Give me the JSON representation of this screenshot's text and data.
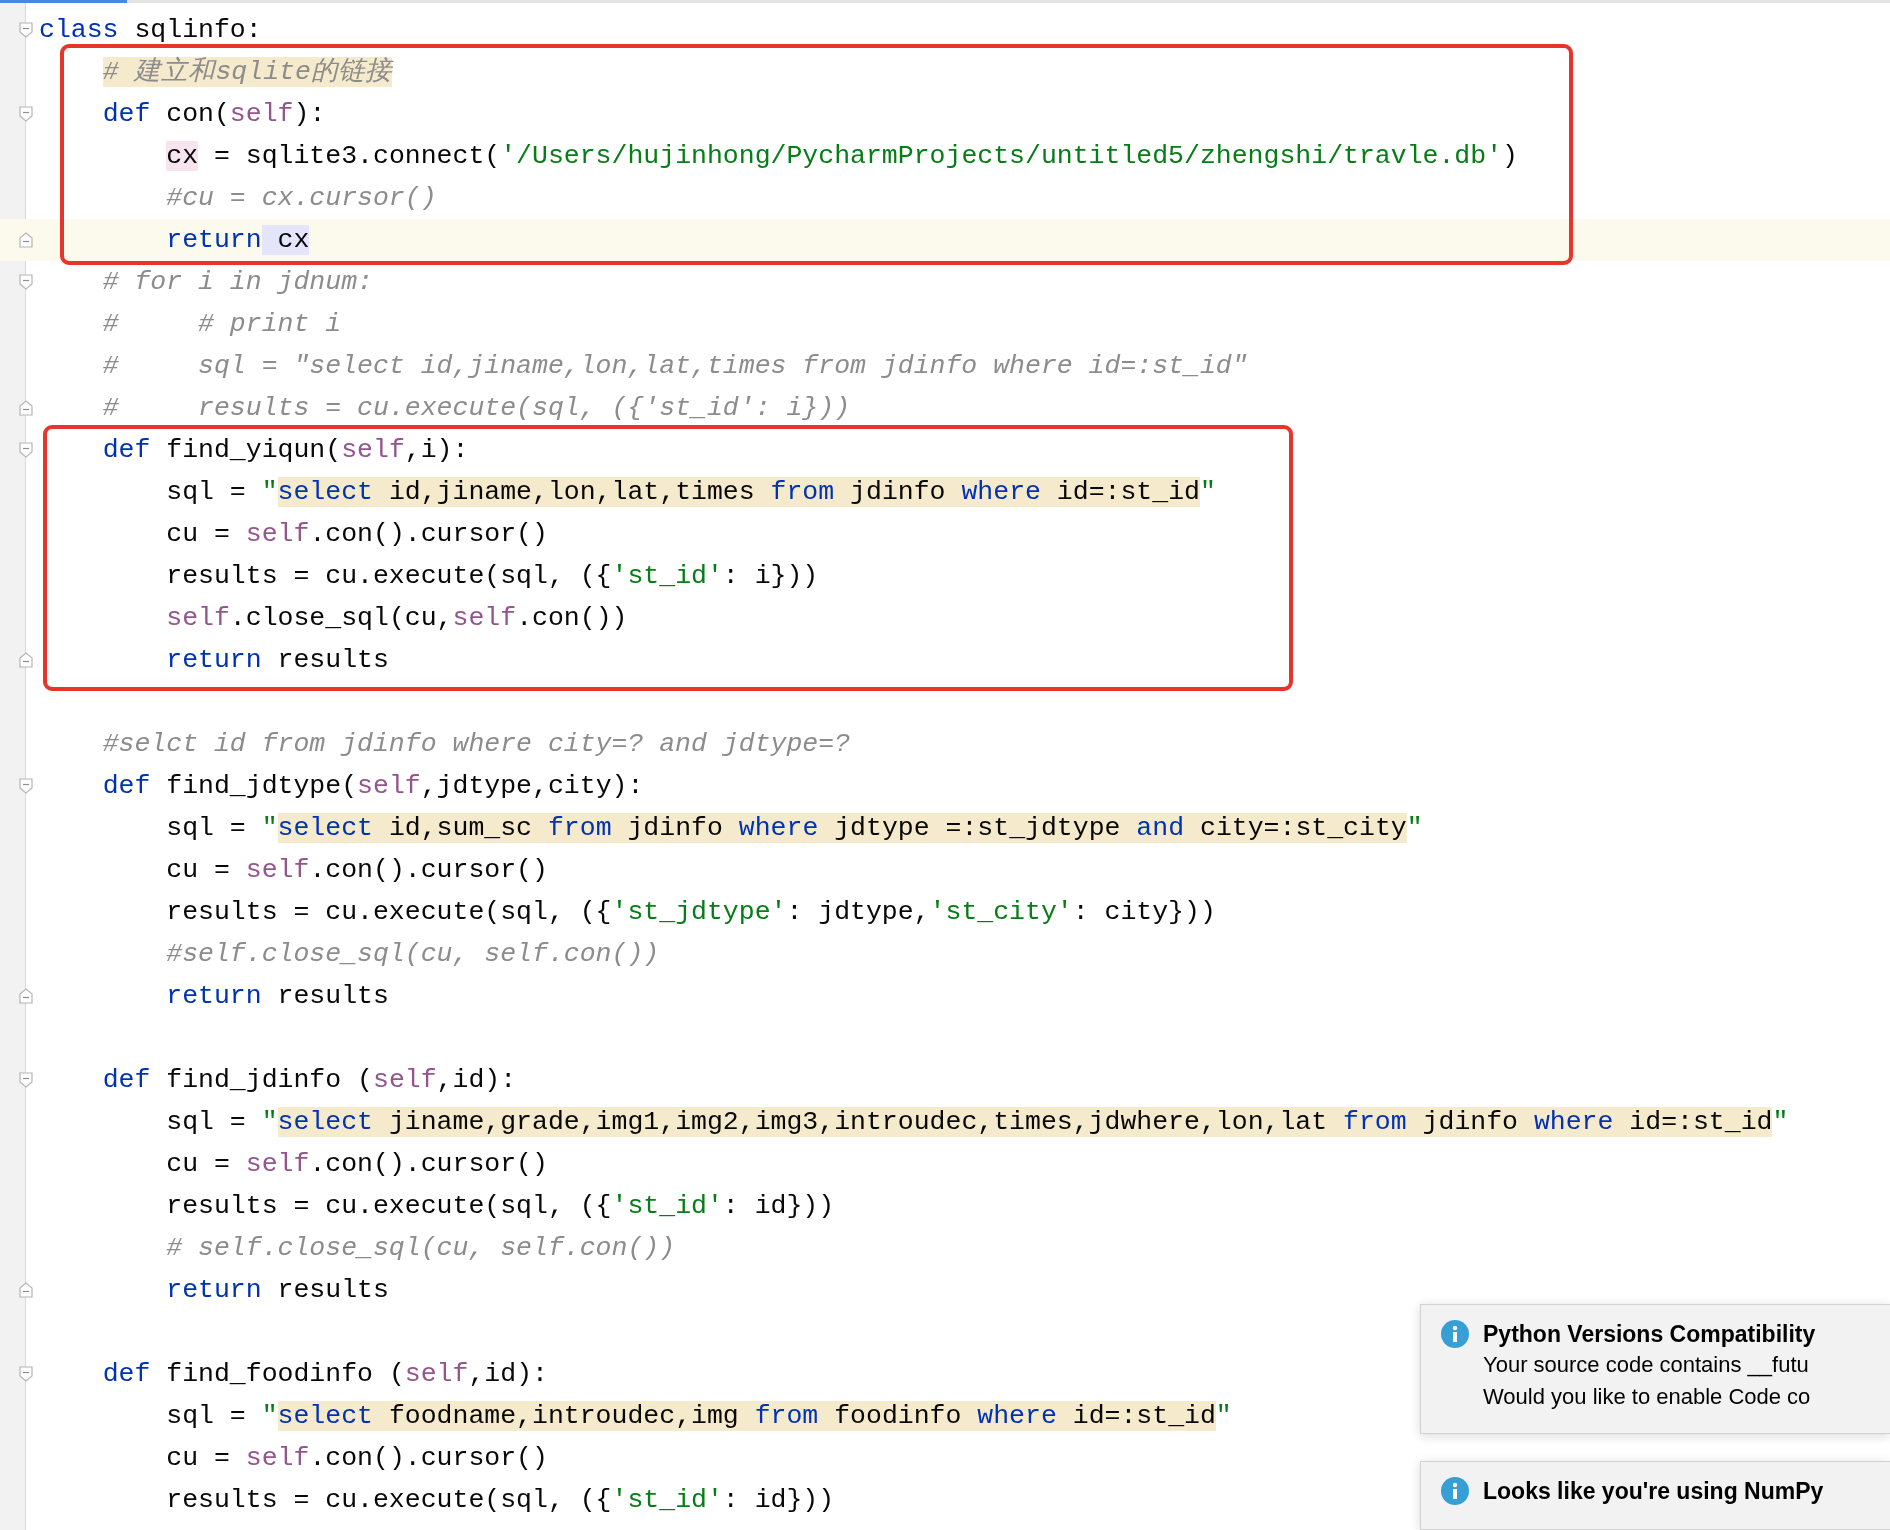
{
  "segments": [
    {
      "kind": "plain",
      "lines": [
        {
          "fold_start": true,
          "fold_end": false,
          "current": false,
          "tokens": [
            {
              "text": "class",
              "kind": "kw"
            },
            {
              "text": " sqlinfo:",
              "kind": "plain"
            }
          ]
        }
      ]
    },
    {
      "kind": "highlight-box",
      "lines": [
        {
          "fold_start": false,
          "fold_end": false,
          "current": false,
          "tokens": [
            {
              "text": "    # 建立和sqlite的链接",
              "kind": "comment-hl"
            }
          ]
        },
        {
          "fold_start": true,
          "fold_end": false,
          "current": false,
          "tokens": [
            {
              "text": "    def",
              "kind": "kw"
            },
            {
              "text": " con(",
              "kind": "plain"
            },
            {
              "text": "self",
              "kind": "self"
            },
            {
              "text": "):",
              "kind": "plain"
            }
          ]
        },
        {
          "fold_start": false,
          "fold_end": false,
          "current": false,
          "tokens": [
            {
              "text": "        cx",
              "kind": "decl"
            },
            {
              "text": " = sqlite3.connect(",
              "kind": "plain"
            },
            {
              "text": "'/Users/hujinhong/PycharmProjects/untitled5/zhengshi/travle.db'",
              "kind": "str"
            },
            {
              "text": ")",
              "kind": "plain"
            }
          ]
        },
        {
          "fold_start": false,
          "fold_end": false,
          "current": false,
          "tokens": [
            {
              "text": "        #cu = cx.cursor()",
              "kind": "comment"
            }
          ]
        },
        {
          "fold_start": false,
          "fold_end": true,
          "current": true,
          "tokens": [
            {
              "text": "        return",
              "kind": "kw"
            },
            {
              "text": " cx",
              "kind": "usage"
            }
          ]
        }
      ]
    },
    {
      "kind": "plain",
      "lines": [
        {
          "fold_start": true,
          "fold_end": false,
          "current": false,
          "tokens": [
            {
              "text": "    # for i in jdnum:",
              "kind": "comment"
            }
          ]
        },
        {
          "fold_start": false,
          "fold_end": false,
          "current": false,
          "tokens": [
            {
              "text": "    #     # print i",
              "kind": "comment"
            }
          ]
        },
        {
          "fold_start": false,
          "fold_end": false,
          "current": false,
          "tokens": [
            {
              "text": "    #     sql = \"select id,jiname,lon,lat,times from jdinfo where id=:st_id\"",
              "kind": "comment"
            }
          ]
        },
        {
          "fold_start": false,
          "fold_end": true,
          "current": false,
          "tokens": [
            {
              "text": "    #     results = cu.execute(sql, ({'st_id': i}))",
              "kind": "comment"
            }
          ]
        }
      ]
    },
    {
      "kind": "highlight-box",
      "lines": [
        {
          "fold_start": true,
          "fold_end": false,
          "current": false,
          "tokens": [
            {
              "text": "    def",
              "kind": "kw"
            },
            {
              "text": " find_yiqun(",
              "kind": "plain"
            },
            {
              "text": "self",
              "kind": "self"
            },
            {
              "text": ",i):",
              "kind": "plain"
            }
          ]
        },
        {
          "fold_start": false,
          "fold_end": false,
          "current": false,
          "tokens": [
            {
              "text": "        sql = ",
              "kind": "plain"
            },
            {
              "text": "\"",
              "kind": "str"
            },
            {
              "text": "select",
              "kind": "sqlkw"
            },
            {
              "text": " id,jiname,lon,lat,times ",
              "kind": "sql"
            },
            {
              "text": "from",
              "kind": "sqlkw"
            },
            {
              "text": " jdinfo ",
              "kind": "sql"
            },
            {
              "text": "where",
              "kind": "sqlkw"
            },
            {
              "text": " id=:st_id",
              "kind": "sql"
            },
            {
              "text": "\"",
              "kind": "str"
            }
          ]
        },
        {
          "fold_start": false,
          "fold_end": false,
          "current": false,
          "tokens": [
            {
              "text": "        cu = ",
              "kind": "plain"
            },
            {
              "text": "self",
              "kind": "self"
            },
            {
              "text": ".con().cursor()",
              "kind": "plain"
            }
          ]
        },
        {
          "fold_start": false,
          "fold_end": false,
          "current": false,
          "tokens": [
            {
              "text": "        results = cu.execute(sql, ({",
              "kind": "plain"
            },
            {
              "text": "'st_id'",
              "kind": "str"
            },
            {
              "text": ": i}))",
              "kind": "plain"
            }
          ]
        },
        {
          "fold_start": false,
          "fold_end": false,
          "current": false,
          "tokens": [
            {
              "text": "        self",
              "kind": "self"
            },
            {
              "text": ".close_sql(cu,",
              "kind": "plain"
            },
            {
              "text": "self",
              "kind": "self"
            },
            {
              "text": ".con())",
              "kind": "plain"
            }
          ]
        },
        {
          "fold_start": false,
          "fold_end": true,
          "current": false,
          "tokens": [
            {
              "text": "        return",
              "kind": "kw"
            },
            {
              "text": " results",
              "kind": "plain"
            }
          ]
        }
      ]
    },
    {
      "kind": "spaced",
      "lines": [
        {
          "fold_start": false,
          "fold_end": false,
          "current": false,
          "tokens": [
            {
              "text": "    #selct id from jdinfo where city=? and jdtype=?",
              "kind": "comment"
            }
          ]
        },
        {
          "fold_start": true,
          "fold_end": false,
          "current": false,
          "tokens": [
            {
              "text": "    def",
              "kind": "kw"
            },
            {
              "text": " find_jdtype(",
              "kind": "plain"
            },
            {
              "text": "self",
              "kind": "self"
            },
            {
              "text": ",jdtype,city):",
              "kind": "plain"
            }
          ]
        },
        {
          "fold_start": false,
          "fold_end": false,
          "current": false,
          "tokens": [
            {
              "text": "        sql = ",
              "kind": "plain"
            },
            {
              "text": "\"",
              "kind": "str"
            },
            {
              "text": "select",
              "kind": "sqlkw"
            },
            {
              "text": " id,sum_sc ",
              "kind": "sql"
            },
            {
              "text": "from",
              "kind": "sqlkw"
            },
            {
              "text": " jdinfo ",
              "kind": "sql"
            },
            {
              "text": "where",
              "kind": "sqlkw"
            },
            {
              "text": " jdtype =:st_jdtype ",
              "kind": "sql"
            },
            {
              "text": "and",
              "kind": "sqlkw"
            },
            {
              "text": " city=:st_city",
              "kind": "sql"
            },
            {
              "text": "\"",
              "kind": "str"
            }
          ]
        },
        {
          "fold_start": false,
          "fold_end": false,
          "current": false,
          "tokens": [
            {
              "text": "        cu = ",
              "kind": "plain"
            },
            {
              "text": "self",
              "kind": "self"
            },
            {
              "text": ".con().cursor()",
              "kind": "plain"
            }
          ]
        },
        {
          "fold_start": false,
          "fold_end": false,
          "current": false,
          "tokens": [
            {
              "text": "        results = cu.execute(sql, ({",
              "kind": "plain"
            },
            {
              "text": "'st_jdtype'",
              "kind": "str"
            },
            {
              "text": ": jdtype,",
              "kind": "plain"
            },
            {
              "text": "'st_city'",
              "kind": "str"
            },
            {
              "text": ": city}))",
              "kind": "plain"
            }
          ]
        },
        {
          "fold_start": false,
          "fold_end": false,
          "current": false,
          "tokens": [
            {
              "text": "        #self.close_sql(cu, self.con())",
              "kind": "comment"
            }
          ]
        },
        {
          "fold_start": false,
          "fold_end": true,
          "current": false,
          "tokens": [
            {
              "text": "        return",
              "kind": "kw"
            },
            {
              "text": " results",
              "kind": "plain"
            }
          ]
        }
      ]
    },
    {
      "kind": "spaced",
      "lines": [
        {
          "fold_start": true,
          "fold_end": false,
          "current": false,
          "tokens": [
            {
              "text": "    def",
              "kind": "kw"
            },
            {
              "text": " find_jdinfo (",
              "kind": "plain"
            },
            {
              "text": "self",
              "kind": "self"
            },
            {
              "text": ",id):",
              "kind": "plain"
            }
          ]
        },
        {
          "fold_start": false,
          "fold_end": false,
          "current": false,
          "tokens": [
            {
              "text": "        sql = ",
              "kind": "plain"
            },
            {
              "text": "\"",
              "kind": "str"
            },
            {
              "text": "select",
              "kind": "sqlkw"
            },
            {
              "text": " jiname,grade,img1,img2,img3,introudec,times,jdwhere,lon,lat ",
              "kind": "sql"
            },
            {
              "text": "from",
              "kind": "sqlkw"
            },
            {
              "text": " jdinfo ",
              "kind": "sql"
            },
            {
              "text": "where",
              "kind": "sqlkw"
            },
            {
              "text": " id=:st_id",
              "kind": "sql"
            },
            {
              "text": "\"",
              "kind": "str"
            }
          ]
        },
        {
          "fold_start": false,
          "fold_end": false,
          "current": false,
          "tokens": [
            {
              "text": "        cu = ",
              "kind": "plain"
            },
            {
              "text": "self",
              "kind": "self"
            },
            {
              "text": ".con().cursor()",
              "kind": "plain"
            }
          ]
        },
        {
          "fold_start": false,
          "fold_end": false,
          "current": false,
          "tokens": [
            {
              "text": "        results = cu.execute(sql, ({",
              "kind": "plain"
            },
            {
              "text": "'st_id'",
              "kind": "str"
            },
            {
              "text": ": id}))",
              "kind": "plain"
            }
          ]
        },
        {
          "fold_start": false,
          "fold_end": false,
          "current": false,
          "tokens": [
            {
              "text": "        # self.close_sql(cu, self.con())",
              "kind": "comment"
            }
          ]
        },
        {
          "fold_start": false,
          "fold_end": true,
          "current": false,
          "tokens": [
            {
              "text": "        return",
              "kind": "kw"
            },
            {
              "text": " results",
              "kind": "plain"
            }
          ]
        }
      ]
    },
    {
      "kind": "spaced",
      "lines": [
        {
          "fold_start": true,
          "fold_end": false,
          "current": false,
          "tokens": [
            {
              "text": "    def",
              "kind": "kw"
            },
            {
              "text": " find_foodinfo (",
              "kind": "plain"
            },
            {
              "text": "self",
              "kind": "self"
            },
            {
              "text": ",id):",
              "kind": "plain"
            }
          ]
        },
        {
          "fold_start": false,
          "fold_end": false,
          "current": false,
          "tokens": [
            {
              "text": "        sql = ",
              "kind": "plain"
            },
            {
              "text": "\"",
              "kind": "str"
            },
            {
              "text": "select",
              "kind": "sqlkw"
            },
            {
              "text": " foodname,introudec,img ",
              "kind": "sql"
            },
            {
              "text": "from",
              "kind": "sqlkw"
            },
            {
              "text": " foodinfo ",
              "kind": "sql"
            },
            {
              "text": "where",
              "kind": "sqlkw"
            },
            {
              "text": " id=:st_id",
              "kind": "sql"
            },
            {
              "text": "\"",
              "kind": "str"
            }
          ]
        },
        {
          "fold_start": false,
          "fold_end": false,
          "current": false,
          "tokens": [
            {
              "text": "        cu = ",
              "kind": "plain"
            },
            {
              "text": "self",
              "kind": "self"
            },
            {
              "text": ".con().cursor()",
              "kind": "plain"
            }
          ]
        },
        {
          "fold_start": false,
          "fold_end": false,
          "current": false,
          "tokens": [
            {
              "text": "        results = cu.execute(sql, ({",
              "kind": "plain"
            },
            {
              "text": "'st_id'",
              "kind": "str"
            },
            {
              "text": ": id}))",
              "kind": "plain"
            }
          ]
        }
      ]
    }
  ],
  "notifications": [
    {
      "title": "Python Versions Compatibility",
      "lines": [
        "Your source code contains __futu",
        "Would you like to enable Code co"
      ]
    },
    {
      "title": "Looks like you're using NumPy"
    }
  ]
}
